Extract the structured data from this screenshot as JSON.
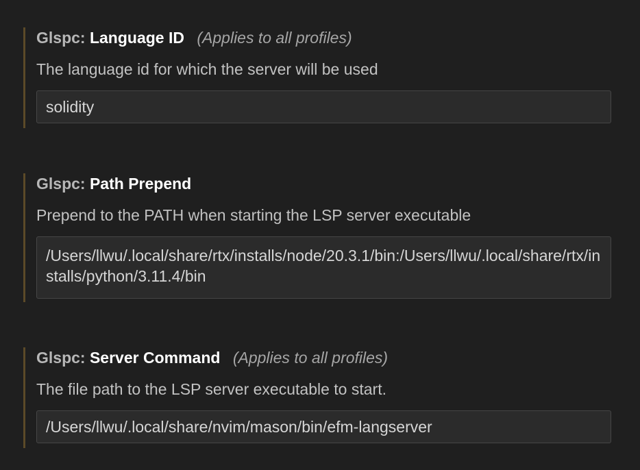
{
  "settings": [
    {
      "category": "Glspc:",
      "label": "Language ID",
      "scope": "(Applies to all profiles)",
      "description": "The language id for which the server will be used",
      "value": "solidity"
    },
    {
      "category": "Glspc:",
      "label": "Path Prepend",
      "scope": "",
      "description": "Prepend to the PATH when starting the LSP server executable",
      "value": "/Users/llwu/.local/share/rtx/installs/node/20.3.1/bin:/Users/llwu/.local/share/rtx/installs/python/3.11.4/bin"
    },
    {
      "category": "Glspc:",
      "label": "Server Command",
      "scope": "(Applies to all profiles)",
      "description": "The file path to the LSP server executable to start.",
      "value": "/Users/llwu/.local/share/nvim/mason/bin/efm-langserver"
    }
  ],
  "colors": {
    "background": "#1f1f1f",
    "modified_indicator": "#5c4a28",
    "input_background": "#2b2b2b",
    "input_border": "#464646"
  }
}
